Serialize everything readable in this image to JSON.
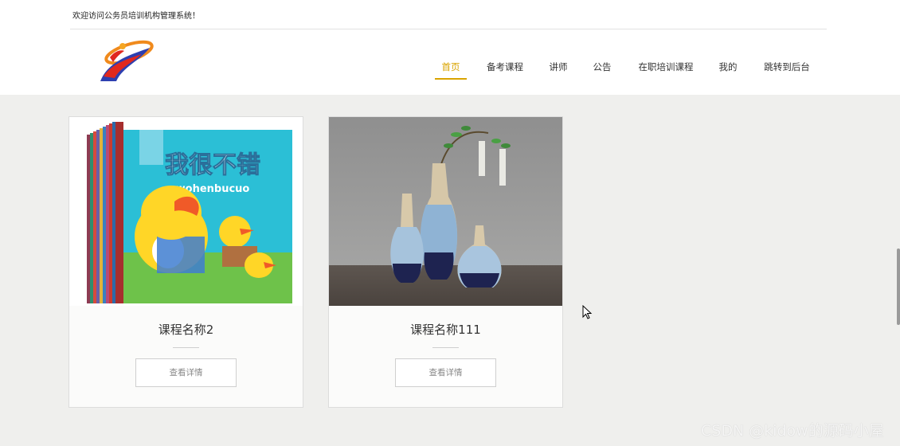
{
  "header": {
    "welcome_text": "欢迎访问公务员培训机构管理系统！",
    "logo_icon": "swirl-logo-icon"
  },
  "nav": {
    "items": [
      {
        "label": "首页",
        "active": true
      },
      {
        "label": "备考课程",
        "active": false
      },
      {
        "label": "讲师",
        "active": false
      },
      {
        "label": "公告",
        "active": false
      },
      {
        "label": "在职培训课程",
        "active": false
      },
      {
        "label": "我的",
        "active": false
      },
      {
        "label": "跳转到后台",
        "active": false
      }
    ],
    "active_color": "#d9a400"
  },
  "cards": [
    {
      "image_icon": "picture-book-cover-image",
      "image_title": "我很不错",
      "image_subtitle": "wohenbucuo",
      "title": "课程名称2",
      "button_label": "查看详情"
    },
    {
      "image_icon": "ceramic-vases-image",
      "title": "课程名称111",
      "button_label": "查看详情"
    }
  ],
  "watermark": "CSDN @kidow的源码小屋",
  "icons": {
    "cursor": "mouse-pointer-icon",
    "scrollbar": "vertical-scrollbar"
  }
}
